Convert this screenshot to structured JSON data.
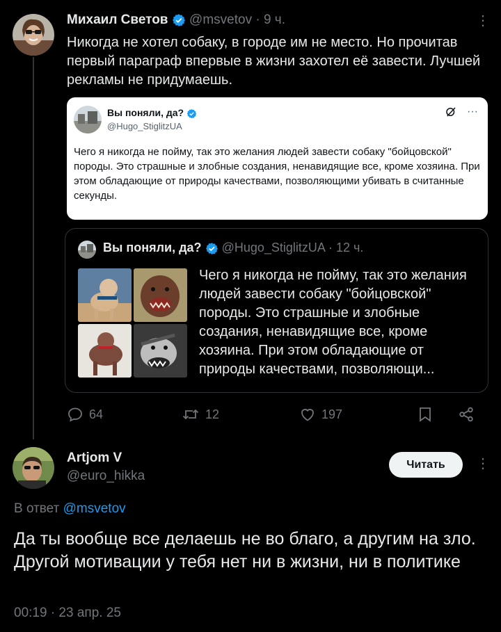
{
  "tweet": {
    "author": "Михаил Светов",
    "handle": "@msvetov",
    "time": "· 9 ч.",
    "text": "Никогда не хотел собаку, в городе им не место. Но прочитав первый параграф впервые в жизни захотел её завести. Лучшей рекламы не придумаешь."
  },
  "screenshot": {
    "author": "Вы поняли, да?",
    "handle": "@Hugo_StiglitzUA",
    "text": "Чего я никогда не пойму, так это желания людей завести собаку \"бойцовской\" породы. Это страшные и злобные создания, ненавидящие все, кроме хозяина. При этом обладающие от природы качествами, позволяющими убивать в считанные секунды."
  },
  "quote": {
    "author": "Вы поняли, да?",
    "handle": "@Hugo_StiglitzUA",
    "time": "· 12 ч.",
    "text": "Чего я никогда не пойму, так это желания людей завести собаку \"бойцовской\" породы. Это страшные и злобные создания, ненавидящие все, кроме хозяина. При этом обладающие от природы качествами, позволяющи..."
  },
  "actions": {
    "replies": "64",
    "retweets": "12",
    "likes": "197"
  },
  "reply": {
    "author": "Artjom V",
    "handle": "@euro_hikka",
    "follow_label": "Читать",
    "reply_to_prefix": "В ответ",
    "reply_to_handle": "@msvetov",
    "text": "Да ты вообще все делаешь не во благо, а другим на зло. Другой мотивации у тебя нет ни в жизни, ни в политике",
    "timestamp": "00:19 · 23 апр. 25"
  },
  "colors": {
    "background": "#000000",
    "text": "#e7e9ea",
    "muted": "#71767b",
    "accent": "#1d9bf0",
    "border": "#2f3336"
  }
}
